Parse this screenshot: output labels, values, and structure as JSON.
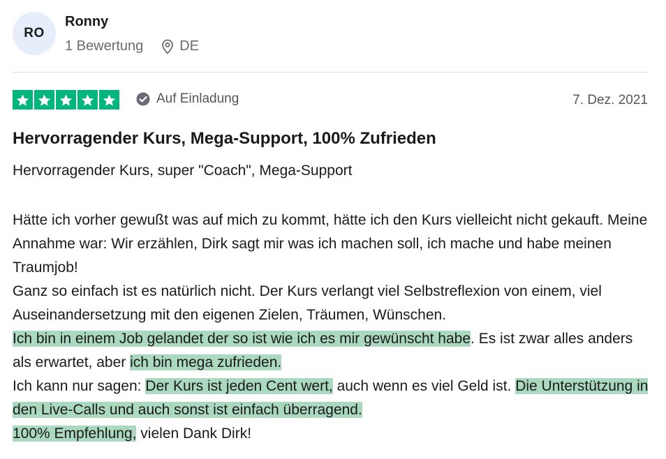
{
  "reviewer": {
    "initials": "RO",
    "name": "Ronny",
    "review_count": "1 Bewertung",
    "location": "DE"
  },
  "review": {
    "rating": 5,
    "rating_max": 5,
    "star_color": "#00b67a",
    "verification_label": "Auf Einladung",
    "date": "7. Dez. 2021",
    "title": "Hervorragender Kurs, Mega-Support, 100% Zufrieden",
    "subtitle": "Hervorragender Kurs, super \"Coach\", Mega-Support",
    "body": {
      "line1": "Hätte ich vorher gewußt was auf mich zu kommt, hätte ich den Kurs vielleicht nicht gekauft. Meine Annahme war: Wir erzählen, Dirk sagt mir was ich machen soll, ich mache und habe meinen Traumjob!",
      "line2": "Ganz so einfach ist es natürlich nicht. Der Kurs verlangt viel Selbstreflexion von einem, viel Auseinandersetzung mit den eigenen Zielen, Träumen, Wünschen.",
      "p3_hl1": "Ich bin in einem Job gelandet der so ist wie ich es mir gewünscht habe",
      "p3_t1": ". Es ist zwar alles anders als erwartet, aber ",
      "p3_hl2": "ich bin mega zufrieden.",
      "p4_t1": "Ich kann nur sagen: ",
      "p4_hl1": "Der Kurs ist jeden Cent wert,",
      "p4_t2": " auch wenn es viel Geld ist. ",
      "p4_hl2": "Die Unterstützung in den Live-Calls und auch sonst ist einfach überragend.",
      "p5_hl1": "100% Empfehlung,",
      "p5_t1": " vielen Dank Dirk!",
      "highlight_color": "#abd9bf"
    }
  },
  "icons": {
    "location": "map-pin-icon",
    "verification": "check-circle-icon",
    "star": "star-icon"
  }
}
